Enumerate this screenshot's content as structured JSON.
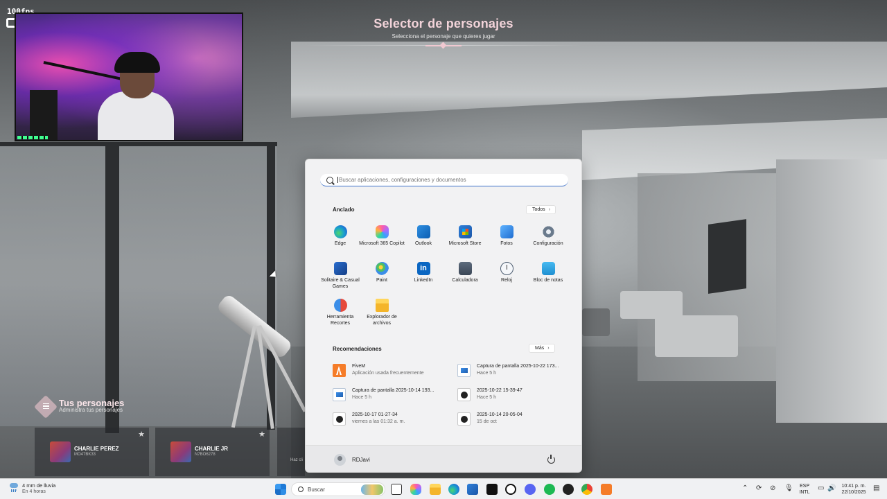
{
  "overlay": {
    "fps": "100fps"
  },
  "selector": {
    "title": "Selector de personajes",
    "subtitle": "Selecciona el personaje que quieres jugar"
  },
  "characters": {
    "section_title": "Tus personajes",
    "section_subtitle": "Administra tus personajes",
    "cards": [
      {
        "name": "CHARLIE PEREZ",
        "id": "MO47BK33"
      },
      {
        "name": "CHARLIE JR",
        "id": "N7BO6278"
      }
    ],
    "partial_text": "Haz cli"
  },
  "start_menu": {
    "search_placeholder": "Buscar aplicaciones, configuraciones y documentos",
    "pinned_title": "Anclado",
    "all_button": "Todos",
    "pinned": [
      {
        "label": "Edge",
        "icon": "edge-icon"
      },
      {
        "label": "Microsoft 365 Copilot",
        "icon": "microsoft-365-copilot-icon"
      },
      {
        "label": "Outlook",
        "icon": "outlook-icon"
      },
      {
        "label": "Microsoft Store",
        "icon": "microsoft-store-icon"
      },
      {
        "label": "Fotos",
        "icon": "photos-icon"
      },
      {
        "label": "Configuración",
        "icon": "settings-gear-icon"
      },
      {
        "label": "Solitaire & Casual Games",
        "icon": "solitaire-icon"
      },
      {
        "label": "Paint",
        "icon": "paint-icon"
      },
      {
        "label": "LinkedIn",
        "icon": "linkedin-icon"
      },
      {
        "label": "Calculadora",
        "icon": "calculator-icon"
      },
      {
        "label": "Reloj",
        "icon": "clock-icon"
      },
      {
        "label": "Bloc de notas",
        "icon": "notepad-icon"
      },
      {
        "label": "Herramienta Recortes",
        "icon": "snipping-tool-icon"
      },
      {
        "label": "Explorador de archivos",
        "icon": "file-explorer-icon"
      }
    ],
    "recommended_title": "Recomendaciones",
    "more_button": "Más",
    "recommended": [
      {
        "name": "FiveM",
        "sub": "Aplicación usada frecuentemente",
        "icon": "fivem-icon"
      },
      {
        "name": "Captura de pantalla 2025-10-22 173...",
        "sub": "Hace 5 h",
        "icon": "image-file-icon"
      },
      {
        "name": "Captura de pantalla 2025-10-14 193...",
        "sub": "Hace 5 h",
        "icon": "image-file-icon"
      },
      {
        "name": "2025-10-22 15-39-47",
        "sub": "Hace 5 h",
        "icon": "video-file-icon"
      },
      {
        "name": "2025-10-17 01-27-34",
        "sub": "viernes a las 01:32 a. m.",
        "icon": "video-file-icon"
      },
      {
        "name": "2025-10-14 20-05-04",
        "sub": "15 de oct",
        "icon": "video-file-icon"
      }
    ],
    "user_name": "RDJavi"
  },
  "taskbar": {
    "weather_main": "4 mm de lluvia",
    "weather_sub": "En 4 horas",
    "search_label": "Buscar",
    "lang_top": "ESP",
    "lang_bottom": "INTL",
    "time": "10:41 p. m.",
    "date": "22/10/2025"
  }
}
